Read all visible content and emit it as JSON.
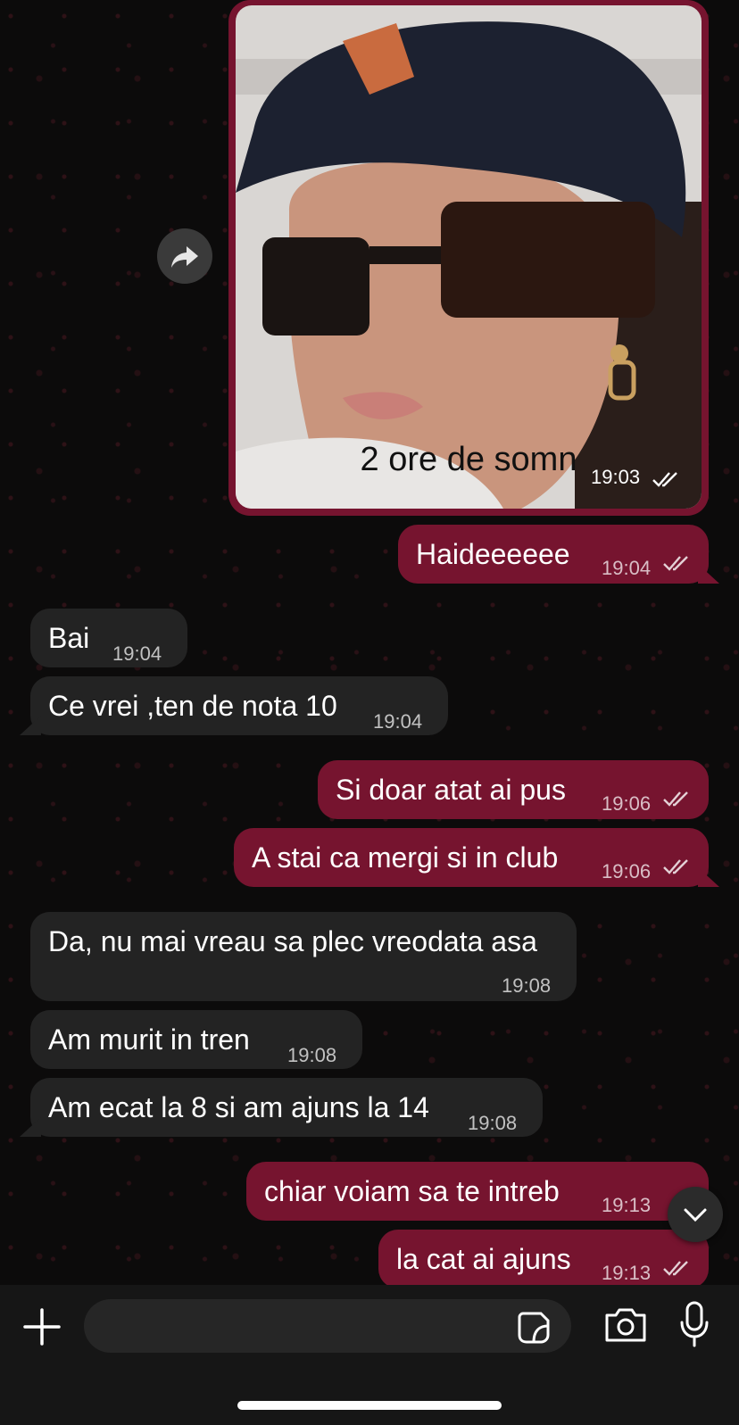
{
  "image_message": {
    "caption": "2 ore de somn",
    "time": "19:03"
  },
  "messages": [
    {
      "text": "Haideeeeee",
      "time": "19:04"
    },
    {
      "text": "Bai",
      "time": "19:04"
    },
    {
      "text": "Ce vrei ,ten de nota 10",
      "time": "19:04"
    },
    {
      "text": "Si doar atat ai pus",
      "time": "19:06"
    },
    {
      "text": "A stai ca mergi si in club",
      "time": "19:06"
    },
    {
      "text": "Da, nu mai vreau sa plec vreodata asa",
      "time": "19:08"
    },
    {
      "text": "Am murit in tren",
      "time": "19:08"
    },
    {
      "text": "Am ecat la 8 si am ajuns la 14",
      "time": "19:08"
    },
    {
      "text": "chiar voiam sa te intreb",
      "time": "19:13"
    },
    {
      "text": "la cat ai ajuns",
      "time": "19:13"
    }
  ],
  "composer": {
    "placeholder": ""
  },
  "colors": {
    "outgoing_bubble": "#76142f",
    "incoming_bubble": "#232323",
    "background": "#0c0b0b"
  },
  "icons": [
    "forward-icon",
    "double-check-icon",
    "chevron-down-icon",
    "plus-icon",
    "sticker-icon",
    "camera-icon",
    "microphone-icon"
  ]
}
